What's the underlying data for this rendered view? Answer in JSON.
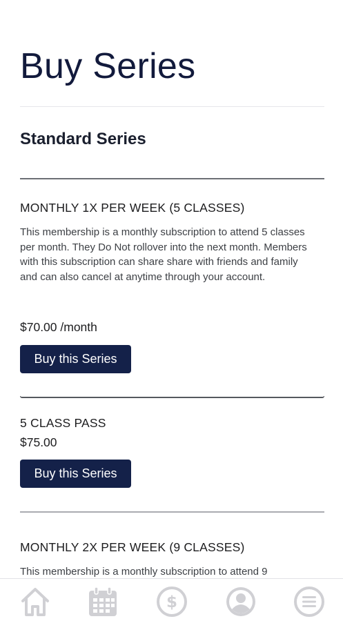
{
  "page": {
    "title": "Buy Series",
    "section_heading": "Standard Series"
  },
  "items": [
    {
      "title": "MONTHLY 1X PER WEEK (5 CLASSES)",
      "description": "This membership is a monthly subscription to attend 5 classes per month. They Do Not rollover into the next month. Members with this subscription can share share with friends and family and can also cancel at anytime through your account.",
      "price": "$70.00 /month",
      "button_label": "Buy this Series"
    },
    {
      "title": "5 CLASS PASS",
      "price": "$75.00",
      "button_label": "Buy this Series"
    },
    {
      "title": "MONTHLY 2X PER WEEK (9 CLASSES)",
      "description": "This membership is a monthly subscription to attend 9"
    }
  ],
  "tab_bar": {
    "tabs": [
      {
        "icon": "home-icon"
      },
      {
        "icon": "calendar-icon"
      },
      {
        "icon": "dollar-icon"
      },
      {
        "icon": "profile-icon"
      },
      {
        "icon": "menu-icon"
      }
    ],
    "icon_color": "#d0d0d4"
  },
  "colors": {
    "title": "#121a3c",
    "button_bg": "#142149",
    "button_text": "#ffffff"
  }
}
